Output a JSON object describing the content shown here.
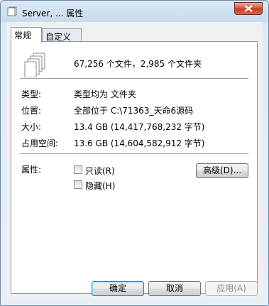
{
  "window": {
    "title": "Server, ... 属性",
    "icon": "folders-icon"
  },
  "tabs": [
    {
      "label": "常规",
      "active": true
    },
    {
      "label": "自定义",
      "active": false
    }
  ],
  "general": {
    "summary": "67,256 个文件，2,985 个文件夹",
    "rows": [
      {
        "label": "类型:",
        "value": "类型均为 文件夹"
      },
      {
        "label": "位置:",
        "value": "全部位于 C:\\71363_天命6源码"
      },
      {
        "label": "大小:",
        "value": "13.4 GB (14,417,768,232 字节)"
      },
      {
        "label": "占用空间:",
        "value": "13.6 GB (14,604,582,912 字节)"
      }
    ],
    "attributes": {
      "label": "属性:",
      "readonly_label": "只读(R)",
      "readonly_checked": false,
      "hidden_label": "隐藏(H)",
      "hidden_checked": false,
      "advanced_button": "高级(D)..."
    }
  },
  "buttons": {
    "ok": "确定",
    "cancel": "取消",
    "apply": "应用(A)"
  }
}
